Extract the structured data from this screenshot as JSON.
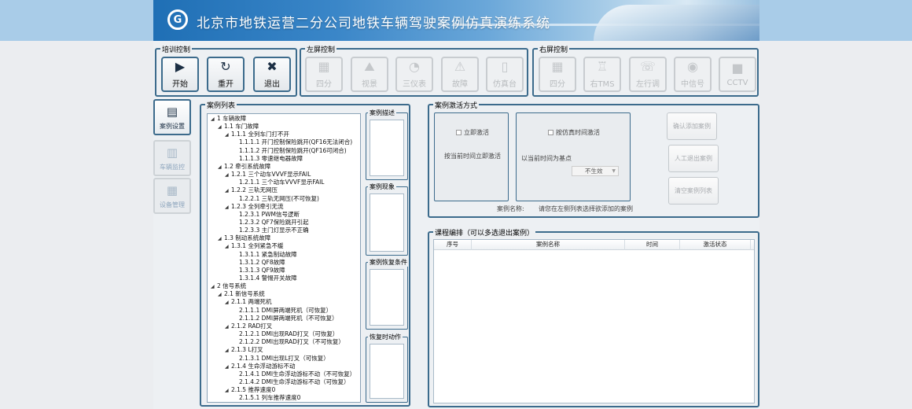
{
  "app": {
    "title": "北京市地铁运营二分公司地铁车辆驾驶案例仿真演练系统",
    "logo_glyph": "G"
  },
  "training_control": {
    "title": "培训控制",
    "buttons": [
      {
        "label": "开始",
        "icon": "play-icon",
        "glyph": "▶"
      },
      {
        "label": "重开",
        "icon": "restart-icon",
        "glyph": "↻"
      },
      {
        "label": "退出",
        "icon": "close-icon",
        "glyph": "✖"
      }
    ]
  },
  "left_screen": {
    "title": "左屏控制",
    "buttons": [
      {
        "label": "四分",
        "icon": "grid-icon",
        "glyph": "▦"
      },
      {
        "label": "视景",
        "icon": "scene-icon",
        "glyph": "⛰"
      },
      {
        "label": "三仪表",
        "icon": "gauge-icon",
        "glyph": "◔"
      },
      {
        "label": "故障",
        "icon": "warning-icon",
        "glyph": "⚠"
      },
      {
        "label": "仿真台",
        "icon": "console-icon",
        "glyph": "▯"
      }
    ]
  },
  "right_screen": {
    "title": "右屏控制",
    "buttons": [
      {
        "label": "四分",
        "icon": "grid-icon",
        "glyph": "▦"
      },
      {
        "label": "右TMS",
        "icon": "train-icon",
        "glyph": "♖"
      },
      {
        "label": "左行调",
        "icon": "phone-icon",
        "glyph": "☏"
      },
      {
        "label": "中信号",
        "icon": "signal-icon",
        "glyph": "◉"
      },
      {
        "label": "CCTV",
        "icon": "camera-icon",
        "glyph": "■"
      }
    ]
  },
  "sidebar": {
    "items": [
      {
        "label": "案例设置",
        "icon": "clipboard-icon",
        "glyph": "▤",
        "state": "active"
      },
      {
        "label": "车辆监控",
        "icon": "book-icon",
        "glyph": "▥",
        "state": "disabled"
      },
      {
        "label": "设备管理",
        "icon": "equipment-icon",
        "glyph": "▦",
        "state": "disabled"
      }
    ]
  },
  "case_list": {
    "title": "案例列表",
    "items": [
      {
        "text": "1 车辆故障",
        "level": 0,
        "expanded": true
      },
      {
        "text": "1.1 车门故障",
        "level": 1,
        "expanded": true
      },
      {
        "text": "1.1.1 全列车门打不开",
        "level": 2,
        "expanded": true
      },
      {
        "text": "1.1.1.1 开门控制保险跳开(QF16无法闭合)",
        "level": 3
      },
      {
        "text": "1.1.1.2 开门控制保险跳开(QF16可闭合)",
        "level": 3
      },
      {
        "text": "1.1.1.3 零速继电器故障",
        "level": 3
      },
      {
        "text": "1.2 牵引系统故障",
        "level": 1,
        "expanded": true
      },
      {
        "text": "1.2.1 三个动车VVVF显示FAIL",
        "level": 2,
        "expanded": true
      },
      {
        "text": "1.2.1.1 三个动车VVVF显示FAIL",
        "level": 3
      },
      {
        "text": "1.2.2 三轨无网压",
        "level": 2,
        "expanded": true
      },
      {
        "text": "1.2.2.1 三轨无网压(不可恢复)",
        "level": 3
      },
      {
        "text": "1.2.3 全列牵引无流",
        "level": 2,
        "expanded": true
      },
      {
        "text": "1.2.3.1 PWM信号逻断",
        "level": 3
      },
      {
        "text": "1.2.3.2 QF7保险跳开引起",
        "level": 3
      },
      {
        "text": "1.2.3.3 主门灯显示不正确",
        "level": 3
      },
      {
        "text": "1.3 制动系统故障",
        "level": 1,
        "expanded": true
      },
      {
        "text": "1.3.1 全列紧急不缓",
        "level": 2,
        "expanded": true
      },
      {
        "text": "1.3.1.1 紧急制动故障",
        "level": 3
      },
      {
        "text": "1.3.1.2 QF8故障",
        "level": 3
      },
      {
        "text": "1.3.1.3 QF9故障",
        "level": 3
      },
      {
        "text": "1.3.1.4 警惕开关故障",
        "level": 3
      },
      {
        "text": "2 信号系统",
        "level": 0,
        "expanded": true
      },
      {
        "text": "2.1 新信号系统",
        "level": 1,
        "expanded": true
      },
      {
        "text": "2.1.1 两端死机",
        "level": 2,
        "expanded": true
      },
      {
        "text": "2.1.1.1 DMI屏两端死机（可恢复）",
        "level": 3
      },
      {
        "text": "2.1.1.2 DMI屏两端死机（不可恢复）",
        "level": 3
      },
      {
        "text": "2.1.2 RAD打叉",
        "level": 2,
        "expanded": true
      },
      {
        "text": "2.1.2.1 DMI出现RAD打叉（可恢复）",
        "level": 3
      },
      {
        "text": "2.1.2.2 DMI出现RAD打叉（不可恢复）",
        "level": 3
      },
      {
        "text": "2.1.3 L打叉",
        "level": 2,
        "expanded": true
      },
      {
        "text": "2.1.3.1 DMI出现L打叉（可恢复）",
        "level": 3
      },
      {
        "text": "2.1.4 生命浮动游标不动",
        "level": 2,
        "expanded": true
      },
      {
        "text": "2.1.4.1 DMI生命浮动游标不动（不可恢复）",
        "level": 3
      },
      {
        "text": "2.1.4.2 DMI生命浮动游标不动（可恢复）",
        "level": 3
      },
      {
        "text": "2.1.5 推荐速度0",
        "level": 2,
        "expanded": true
      },
      {
        "text": "2.1.5.1 列车推荐速度0",
        "level": 3
      }
    ]
  },
  "case_info": {
    "description_title": "案例描述",
    "phenomenon_title": "案例现象",
    "recovery_condition_title": "案例恢复条件",
    "recovery_action_title": "恢复时动作"
  },
  "activation": {
    "title": "案例激活方式",
    "immediate_checkbox": "立即激活",
    "immediate_desc": "按当前时间立即激活",
    "sim_time_checkbox": "按仿真时间激活",
    "sim_time_desc": "以当前时间为基点",
    "effect_select": "不生效",
    "case_name_label": "案例名称:",
    "case_name_hint": "请您在左侧列表选择欲添加的案例",
    "confirm_add": "确认添加案例",
    "manual_exit": "人工退出案例",
    "clear_list": "清空案例列表"
  },
  "schedule": {
    "title": "课程编排（可以多选退出案例）",
    "columns": [
      "序号",
      "案例名称",
      "时间",
      "激活状态"
    ]
  },
  "colors": {
    "border": "#3c6b8c",
    "banner": "#1f6fb5",
    "page_top": "#a9cce8"
  }
}
